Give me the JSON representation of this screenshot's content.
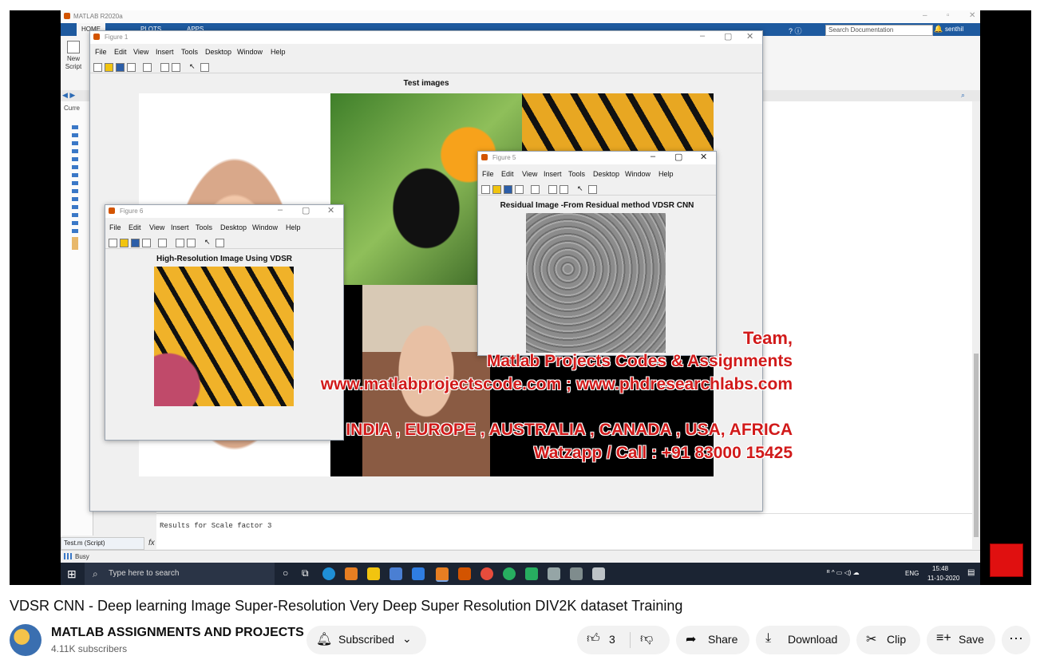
{
  "matlab": {
    "window_title": "MATLAB R2020a",
    "ribbon_tabs": [
      "HOME",
      "PLOTS",
      "APPS"
    ],
    "search_placeholder": "Search Documentation",
    "user": "senthil",
    "new_script_label": "New Script",
    "current_folder_label": "Curre",
    "command_output": "Results for Scale factor 3",
    "fx": "fx",
    "editor_tab": "Test.m (Script)",
    "status": "Busy"
  },
  "figures": {
    "figure1": {
      "title": "Figure 1",
      "menu": [
        "File",
        "Edit",
        "View",
        "Insert",
        "Tools",
        "Desktop",
        "Window",
        "Help"
      ],
      "axes_title": "Test images"
    },
    "figure5": {
      "title": "Figure 5",
      "menu": [
        "File",
        "Edit",
        "View",
        "Insert",
        "Tools",
        "Desktop",
        "Window",
        "Help"
      ],
      "axes_title": "Residual Image -From Residual method VDSR CNN"
    },
    "figure6": {
      "title": "Figure 6",
      "menu": [
        "File",
        "Edit",
        "View",
        "Insert",
        "Tools",
        "Desktop",
        "Window",
        "Help"
      ],
      "axes_title": "High-Resolution Image Using VDSR"
    }
  },
  "overlay": {
    "line1": "Team,",
    "line2": "Matlab Projects Codes & Assignments",
    "line3": "www.matlabprojectscode.com ; www.phdresearchlabs.com",
    "line4": "INDIA , EUROPE , AUSTRALIA , CANADA , USA, AFRICA",
    "line5": "Watzapp / Call : +91 83000 15425"
  },
  "taskbar": {
    "search_placeholder": "Type here to search",
    "lang": "ENG",
    "time": "15:48",
    "date": "11-10-2020"
  },
  "video": {
    "title": "VDSR CNN - Deep learning Image Super-Resolution Very Deep Super Resolution DIV2K dataset Training",
    "channel": "MATLAB ASSIGNMENTS AND PROJECTS",
    "subscribers": "4.11K subscribers",
    "subscribe_label": "Subscribed",
    "likes": "3",
    "share_label": "Share",
    "download_label": "Download",
    "clip_label": "Clip",
    "save_label": "Save"
  },
  "colors": {
    "overlay_red": "#d11a1a",
    "matlab_blue": "#1e5a9f",
    "taskbar": "#1b2433"
  }
}
